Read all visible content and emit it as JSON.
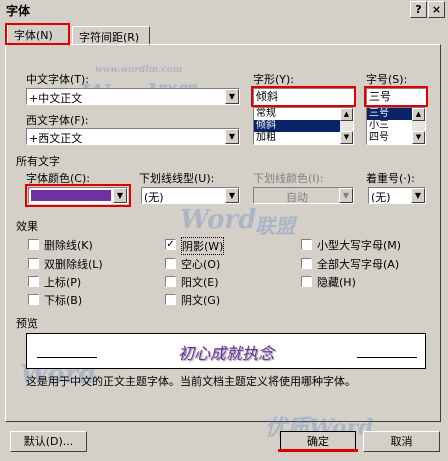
{
  "window": {
    "title": "字体",
    "help_btn": "?",
    "close_btn": "×"
  },
  "tabs": [
    {
      "label": "字体(N)"
    },
    {
      "label": "字符间距(R)"
    }
  ],
  "font": {
    "chinese_label": "中文字体(T):",
    "chinese_value": "+中文正文",
    "western_label": "西文字体(F):",
    "western_value": "+西文正文",
    "style_label": "字形(Y):",
    "style_value": "倾斜",
    "style_options": [
      "常规",
      "倾斜",
      "加粗"
    ],
    "size_label": "字号(S):",
    "size_value": "三号",
    "size_options": [
      "三号",
      "小三",
      "四号"
    ]
  },
  "all_text": {
    "section_label": "所有文字",
    "color_label": "字体颜色(C):",
    "color_value": "#7030a0",
    "underline_label": "下划线线型(U):",
    "underline_value": "(无)",
    "underline_color_label": "下划线颜色(I):",
    "underline_color_value": "自动",
    "emphasis_label": "着重号(·):",
    "emphasis_value": "(无)"
  },
  "effects": {
    "section_label": "效果",
    "items": [
      {
        "label": "删除线(K)",
        "checked": false
      },
      {
        "label": "双删除线(L)",
        "checked": false
      },
      {
        "label": "上标(P)",
        "checked": false
      },
      {
        "label": "下标(B)",
        "checked": false
      },
      {
        "label": "阴影(W)",
        "checked": true
      },
      {
        "label": "空心(O)",
        "checked": false
      },
      {
        "label": "阳文(E)",
        "checked": false
      },
      {
        "label": "阴文(G)",
        "checked": false
      },
      {
        "label": "小型大写字母(M)",
        "checked": false
      },
      {
        "label": "全部大写字母(A)",
        "checked": false
      },
      {
        "label": "隐藏(H)",
        "checked": false
      }
    ]
  },
  "preview": {
    "section_label": "预览",
    "sample_text": "初心成就执念",
    "description": "这是用于中文的正文主题字体。当前文档主题定义将使用哪种字体。"
  },
  "buttons": {
    "default": "默认(D)...",
    "ok": "确定",
    "cancel": "取消"
  },
  "watermarks": {
    "word": "Word",
    "lianmeng": "联盟",
    "site": "www.wordlm.com",
    "bottom": "优质Word"
  },
  "colors": {
    "highlight": "#e00000",
    "selection": "#0a246a",
    "font_color": "#7030a0"
  }
}
